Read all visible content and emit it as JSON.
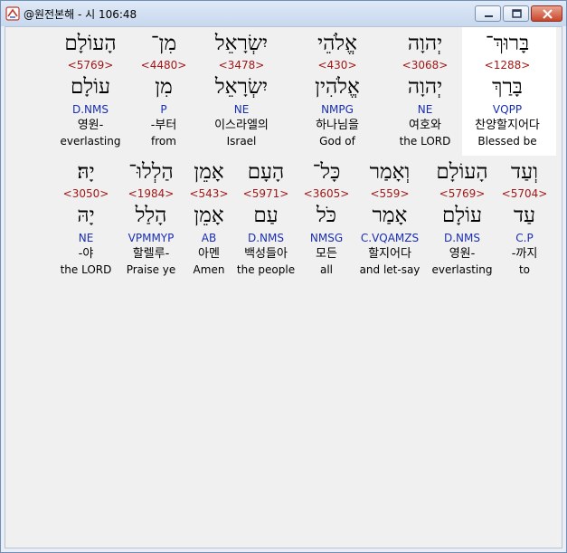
{
  "window": {
    "title": "@원전본해 - 시 106:48"
  },
  "rows": [
    {
      "words": [
        {
          "heb": "בָּרוּךְ־",
          "num": "<1288>",
          "lemma": "בָּרַךְ",
          "parse": "VQPP",
          "ko": "찬양할지어다",
          "en": "Blessed be"
        },
        {
          "heb": "יְהוָה",
          "num": "<3068>",
          "lemma": "יְהוָה",
          "parse": "NE",
          "ko": "여호와",
          "en": "the LORD"
        },
        {
          "heb": "אֱלֹהֵי",
          "num": "<430>",
          "lemma": "אֱלֹהִין",
          "parse": "NMPG",
          "ko": "하나님을",
          "en": "God of"
        },
        {
          "heb": "יִשְׂרָאֵל",
          "num": "<3478>",
          "lemma": "יִשְׂרָאֵל",
          "parse": "NE",
          "ko": "이스라엘의",
          "en": "Israel"
        },
        {
          "heb": "מִן־",
          "num": "<4480>",
          "lemma": "מִן",
          "parse": "P",
          "ko": "-부터",
          "en": "from"
        },
        {
          "heb": "הָעוֹלָם",
          "num": "<5769>",
          "lemma": "עוֹלָם",
          "parse": "D.NMS",
          "ko": "영원-",
          "en": "everlasting"
        }
      ]
    },
    {
      "words": [
        {
          "heb": "וְעַד",
          "num": "<5704>",
          "lemma": "עַד",
          "parse": "C.P",
          "ko": "-까지",
          "en": "to"
        },
        {
          "heb": "הָעוֹלָם",
          "num": "<5769>",
          "lemma": "עוֹלָם",
          "parse": "D.NMS",
          "ko": "영원-",
          "en": "everlasting"
        },
        {
          "heb": "וְאָמַר",
          "num": "<559>",
          "lemma": "אָמַר",
          "parse": "C.VQAMZS",
          "ko": "할지어다",
          "en": "and let-say"
        },
        {
          "heb": "כָּל־",
          "num": "<3605>",
          "lemma": "כֹּל",
          "parse": "NMSG",
          "ko": "모든",
          "en": "all"
        },
        {
          "heb": "הָעָם",
          "num": "<5971>",
          "lemma": "עַם",
          "parse": "D.NMS",
          "ko": "백성들아",
          "en": "the people"
        },
        {
          "heb": "אָמֵן",
          "num": "<543>",
          "lemma": "אָמֵן",
          "parse": "AB",
          "ko": "아멘",
          "en": "Amen"
        },
        {
          "heb": "הַלְלוּ־",
          "num": "<1984>",
          "lemma": "הָלַל",
          "parse": "VPMMYP",
          "ko": "할렐루-",
          "en": "Praise ye"
        },
        {
          "heb": "יָהּ׃",
          "num": "<3050>",
          "lemma": "יָהּ",
          "parse": "NE",
          "ko": "-야",
          "en": "the LORD"
        }
      ]
    }
  ],
  "colors": {
    "strong": "#a01818",
    "parse": "#1a2fb0",
    "highlight": "#ffffff"
  }
}
